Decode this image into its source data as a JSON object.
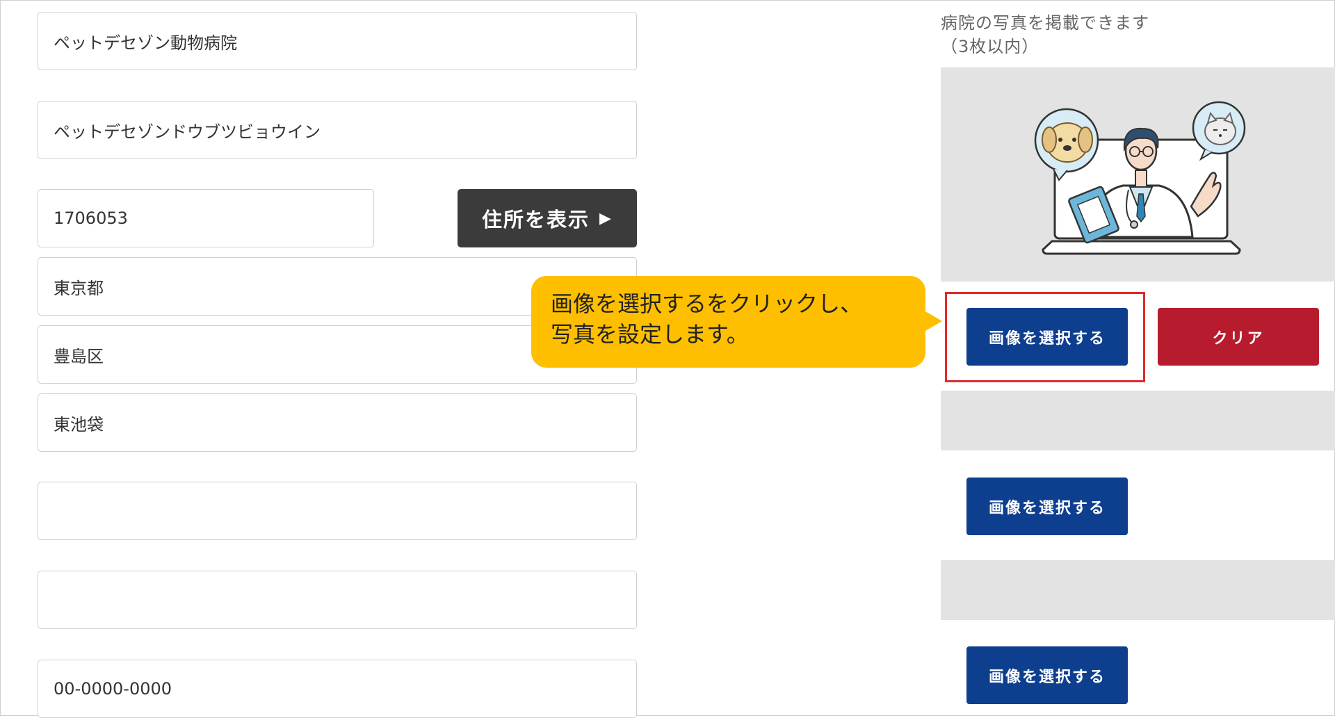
{
  "form": {
    "hospital_name": "ペットデセゾン動物病院",
    "hospital_kana": "ペットデセゾンドウブツビョウイン",
    "postal_code": "1706053",
    "prefecture": "東京都",
    "city": "豊島区",
    "town": "東池袋",
    "address_line": "",
    "building": "",
    "phone_placeholder": "00-0000-0000"
  },
  "address_button": {
    "label": "住所を表示",
    "arrow": "▶"
  },
  "photos": {
    "note_line1": "病院の写真を掲載できます",
    "note_line2": "（3枚以内）",
    "select_label": "画像を選択する",
    "clear_label": "クリア"
  },
  "callout": {
    "line1": "画像を選択するをクリックし、",
    "line2": "写真を設定します。"
  },
  "colors": {
    "select_button": "#0e3f8f",
    "clear_button": "#b71c2e",
    "callout": "#fdbf00",
    "highlight": "#e02a2a",
    "zip_button": "#3b3b3b"
  },
  "icons": {
    "preview_image": "vet-online-consultation-illustration"
  }
}
